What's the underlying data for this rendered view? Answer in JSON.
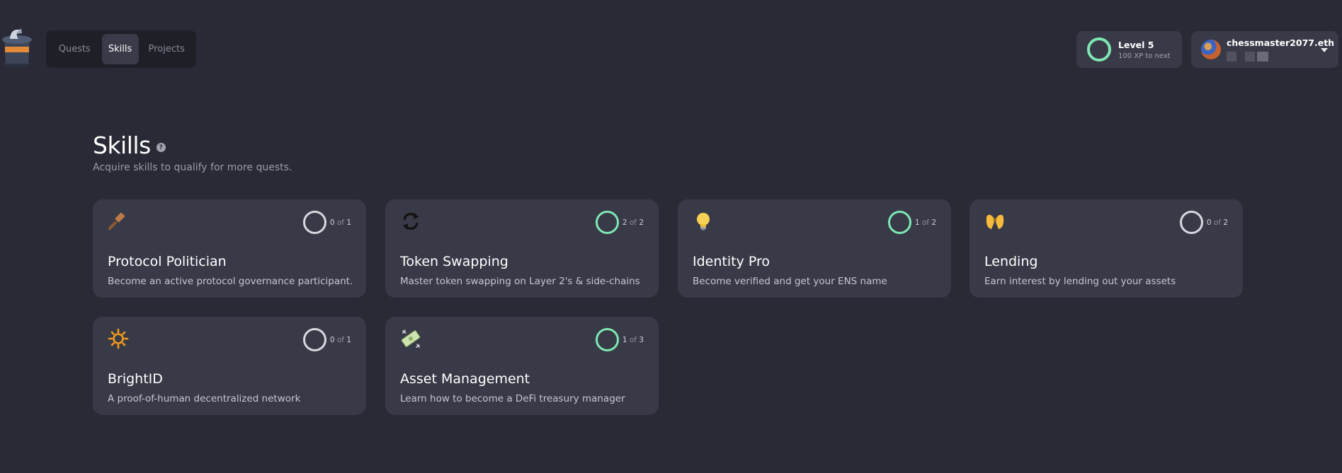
{
  "nav": {
    "tabs": [
      {
        "label": "Quests"
      },
      {
        "label": "Skills"
      },
      {
        "label": "Projects"
      }
    ]
  },
  "level": {
    "title": "Level 5",
    "subtitle": "100 XP to next"
  },
  "user": {
    "name": "chessmaster2077.eth"
  },
  "page": {
    "title": "Skills",
    "help": "?",
    "subtitle": "Acquire skills to qualify for more quests."
  },
  "of_word": "of",
  "skills": [
    {
      "title": "Protocol Politician",
      "description": "Become an active protocol governance participant.",
      "done": "0",
      "total": "1",
      "icon": "gavel-icon",
      "complete": false
    },
    {
      "title": "Token Swapping",
      "description": "Master token swapping on Layer 2's & side-chains",
      "done": "2",
      "total": "2",
      "icon": "swap-icon",
      "complete": true
    },
    {
      "title": "Identity Pro",
      "description": "Become verified and get your ENS name",
      "done": "1",
      "total": "2",
      "icon": "lightbulb-icon",
      "complete": true
    },
    {
      "title": "Lending",
      "description": "Earn interest by lending out your assets",
      "done": "0",
      "total": "2",
      "icon": "hands-icon",
      "complete": false
    },
    {
      "title": "BrightID",
      "description": "A proof-of-human decentralized network",
      "done": "0",
      "total": "1",
      "icon": "sun-icon",
      "complete": false
    },
    {
      "title": "Asset Management",
      "description": "Learn how to become a DeFi treasury manager",
      "done": "1",
      "total": "3",
      "icon": "money-icon",
      "complete": true
    }
  ],
  "colors": {
    "background": "#292a35",
    "card": "#393a47",
    "accent": "#7ee8b3"
  }
}
